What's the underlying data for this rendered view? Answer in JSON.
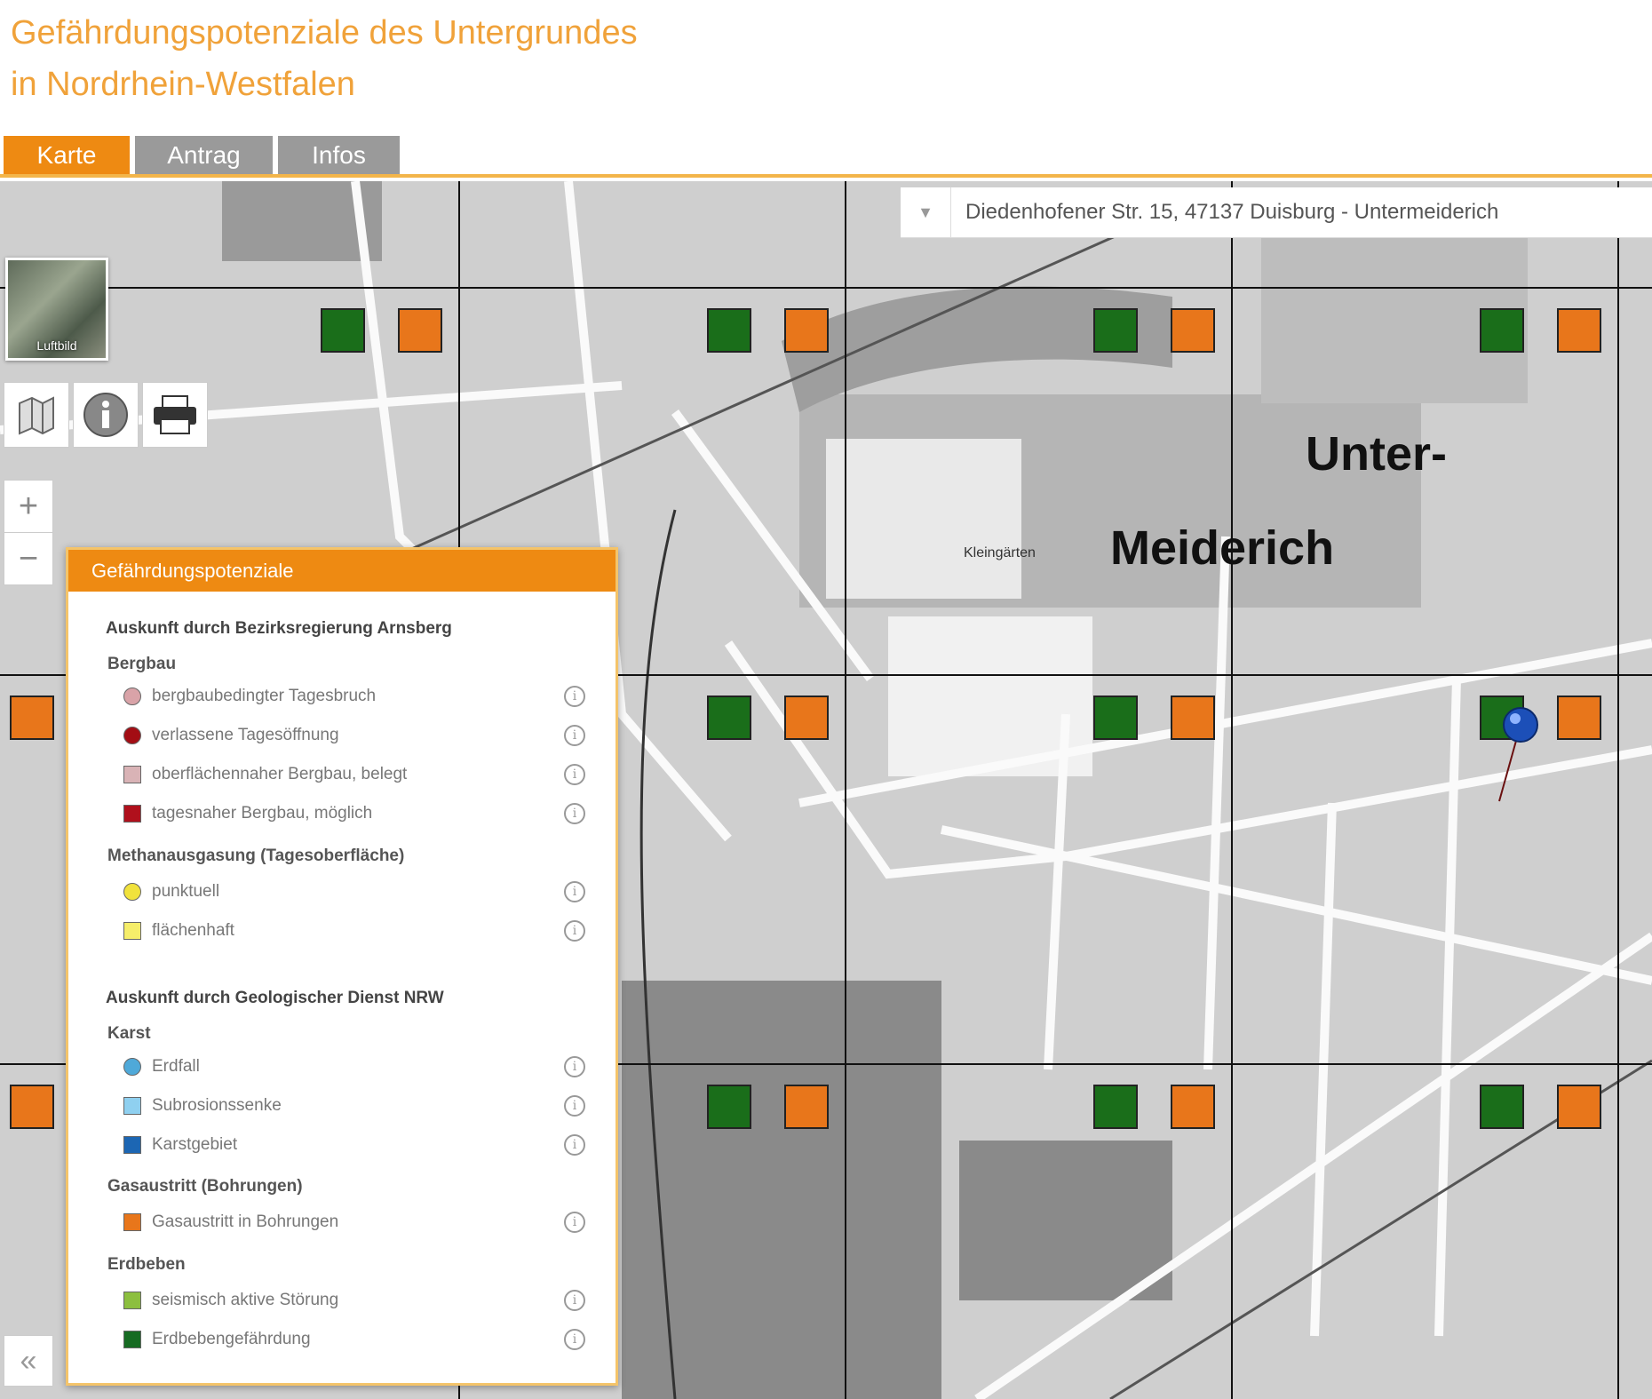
{
  "header": {
    "title_line1": "Gefährdungspotenziale des Untergrundes",
    "title_line2": "in Nordrhein-Westfalen"
  },
  "tabs": [
    {
      "label": "Karte",
      "active": true
    },
    {
      "label": "Antrag",
      "active": false
    },
    {
      "label": "Infos",
      "active": false
    }
  ],
  "search": {
    "value": "Diedenhofener Str. 15, 47137 Duisburg - Untermeiderich"
  },
  "basemap_toggle": {
    "label": "Luftbild"
  },
  "map": {
    "place_label_1": "Unter-",
    "place_label_2": "Meiderich",
    "label_kleingaerten": "Kleingärten",
    "marker_colors": {
      "green": "#1a6e1a",
      "orange": "#e8761b"
    }
  },
  "tools": {
    "info_icon": "info-icon",
    "print_icon": "printer-icon",
    "map_icon": "map-icon"
  },
  "legend": {
    "title": "Gefährdungspotenziale",
    "section1": "Auskunft durch Bezirksregierung Arnsberg",
    "group_bergbau": "Bergbau",
    "item_tagesbruch": "bergbaubedingter Tagesbruch",
    "item_tagesoeffnung": "verlassene Tagesöffnung",
    "item_oberflaechennah": "oberflächennaher Bergbau, belegt",
    "item_tagesnah": "tagesnaher Bergbau, möglich",
    "group_methan": "Methanausgasung (Tagesoberfläche)",
    "item_punktuell": "punktuell",
    "item_flaechenhaft": "flächenhaft",
    "section2": "Auskunft durch Geologischer Dienst NRW",
    "group_karst": "Karst",
    "item_erdfall": "Erdfall",
    "item_subrosion": "Subrosionssenke",
    "item_karstgebiet": "Karstgebiet",
    "group_gas": "Gasaustritt (Bohrungen)",
    "item_gas": "Gasaustritt in Bohrungen",
    "group_erdbeben": "Erdbeben",
    "item_seismisch": "seismisch aktive Störung",
    "item_erdbebengef": "Erdbebengefährdung",
    "info_glyph": "i"
  },
  "legend_colors": {
    "tagesbruch": "#d9a3a8",
    "tagesoeffnung": "#a30d14",
    "oberflaechennah": "#d9b3b6",
    "tagesnah": "#b0101c",
    "punktuell": "#f1e23c",
    "flaechenhaft": "#f6ee6a",
    "erdfall": "#4fa9d9",
    "subrosion": "#8fd0f0",
    "karstgebiet": "#1c66b3",
    "gas": "#e8761b",
    "seismisch": "#8cbf3f",
    "erdbebengef": "#166b22"
  },
  "controls": {
    "zoom_in": "+",
    "zoom_out": "−",
    "collapse": "«"
  }
}
